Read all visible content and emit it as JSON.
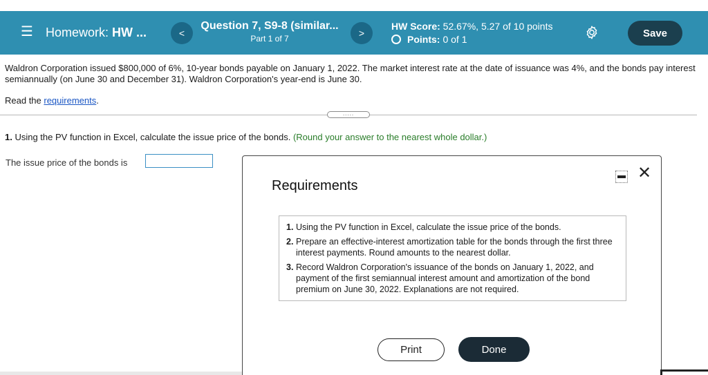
{
  "header": {
    "menu_icon": "hamburger-icon",
    "homework_prefix": "Homework: ",
    "homework_name": "HW ...",
    "question_title": "Question 7, S9-8 (similar...",
    "question_part": "Part 1 of 7",
    "score_label": "HW Score:",
    "score_value": " 52.67%, 5.27 of 10 points",
    "points_label": "Points:",
    "points_value": "0 of 1",
    "prev_label": "<",
    "next_label": ">",
    "settings_icon": "gear-icon",
    "save_label": "Save",
    "bar_color": "#2f8fb1"
  },
  "question": {
    "prompt": "Waldron Corporation issued $800,000 of 6%, 10-year bonds payable on January 1, 2022. The market interest rate at the date of issuance was 4%, and the bonds pay interest semiannually (on June 30 and December 31). Waldron Corporation's year-end is June 30.",
    "read_prefix": "Read the ",
    "read_link": "requirements",
    "read_suffix": ".",
    "divider_handle": "....."
  },
  "part1": {
    "number": "1.",
    "text": " Using the PV function in Excel, calculate the issue price of the bonds. ",
    "hint": "(Round your answer to the nearest whole dollar.)",
    "answer_label": "The issue price of the bonds is",
    "answer_value": ""
  },
  "modal": {
    "title": "Requirements",
    "minimize_icon": "minimize-icon",
    "close_icon": "close-icon",
    "close_glyph": "✕",
    "items": [
      {
        "num": "1.",
        "text": "Using the PV function in Excel, calculate the issue price of the bonds."
      },
      {
        "num": "2.",
        "text": "Prepare an effective-interest amortization table for the bonds through the first three interest payments. Round amounts to the nearest dollar."
      },
      {
        "num": "3.",
        "text": "Record Waldron Corporation's issuance of the bonds on January 1, 2022, and payment of the first semiannual interest amount and amortization of the bond premium on June 30, 2022. Explanations are not required."
      }
    ],
    "print_label": "Print",
    "done_label": "Done"
  }
}
